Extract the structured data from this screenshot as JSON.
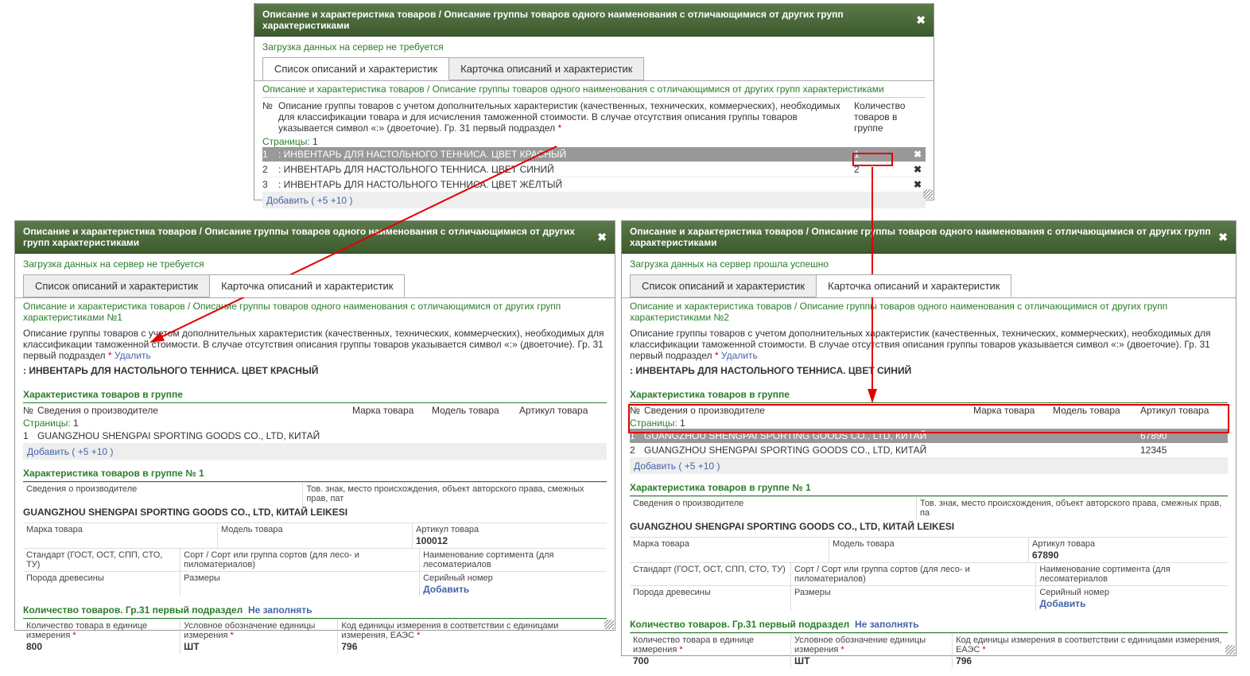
{
  "top": {
    "title": "Описание и характеристика товаров / Описание группы товаров одного наименования с отличающимися от других групп характеристиками",
    "status": "Загрузка данных на сервер не требуется",
    "tab1": "Список описаний и характеристик",
    "tab2": "Карточка описаний и характеристик",
    "breadcrumb": "Описание и характеристика товаров / Описание группы товаров одного наименования с отличающимися от других групп характеристиками",
    "colN": "№",
    "colDesc": "Описание группы товаров с учетом дополнительных характеристик (качественных, технических, коммерческих), необходимых для классификации товара и для исчисления таможенной стоимости. В случае отсутствия описания группы товаров указывается символ «:» (двоеточие). Гр. 31 первый подраздел",
    "colQty": "Количество товаров в группе",
    "pages": "Страницы:",
    "pageNum": "1",
    "rows": [
      {
        "n": "1",
        "text": ": ИНВЕНТАРЬ ДЛЯ НАСТОЛЬНОГО ТЕННИСА. ЦВЕТ КРАСНЫЙ",
        "qty": "1",
        "del": "✖"
      },
      {
        "n": "2",
        "text": ": ИНВЕНТАРЬ ДЛЯ НАСТОЛЬНОГО ТЕННИСА. ЦВЕТ СИНИЙ",
        "qty": "2",
        "del": "✖"
      },
      {
        "n": "3",
        "text": ": ИНВЕНТАРЬ ДЛЯ НАСТОЛЬНОГО ТЕННИСА. ЦВЕТ ЖЁЛТЫЙ",
        "qty": "",
        "del": "✖"
      }
    ],
    "add": "Добавить",
    "a5": "( +5",
    "a10": "+10 )"
  },
  "left": {
    "title": "Описание и характеристика товаров / Описание группы товаров одного наименования с отличающимися от других групп характеристиками",
    "status": "Загрузка данных на сервер не требуется",
    "tab1": "Список описаний и характеристик",
    "tab2": "Карточка описаний и характеристик",
    "breadcrumb": "Описание и характеристика товаров / Описание группы товаров одного наименования с отличающимися от других групп характеристиками №1",
    "descHint": "Описание группы товаров с учетом дополнительных характеристик (качественных, технических, коммерческих), необходимых для классификации таможенной стоимости. В случае отсутствия описания группы товаров указывается символ «:» (двоеточие). Гр. 31 первый подраздел",
    "delete": "Удалить",
    "descValue": ": ИНВЕНТАРЬ ДЛЯ НАСТОЛЬНОГО ТЕННИСА. ЦВЕТ КРАСНЫЙ",
    "sect1": "Характеристика товаров в группе",
    "hN": "№",
    "hMfr": "Сведения о производителе",
    "hBrand": "Марка товара",
    "hModel": "Модель товара",
    "hArt": "Артикул товара",
    "pages": "Страницы:",
    "pageNum": "1",
    "mrows": [
      {
        "n": "1",
        "mfr": "GUANGZHOU SHENGPAI SPORTING GOODS CO., LTD, КИТАЙ",
        "brand": "",
        "model": "",
        "art": ""
      }
    ],
    "add": "Добавить",
    "a5": "( +5",
    "a10": "+10 )",
    "sect2": "Характеристика товаров в группе № 1",
    "mfrLabel": "Сведения о производителе",
    "tovZnak": "Тов. знак, место происхождения, объект авторского права, смежных прав, пат",
    "mfrVal": "GUANGZHOU SHENGPAI SPORTING GOODS CO., LTD, КИТАЙ LEIKESI",
    "brandL": "Марка товара",
    "modelL": "Модель товара",
    "artL": "Артикул товара",
    "artV": "100012",
    "gostL": "Стандарт (ГОСТ, ОСТ, СПП, СТО, ТУ)",
    "sortL": "Сорт / Сорт или группа сортов (для лесо- и пиломатериалов)",
    "naimL": "Наименование сортимента (для лесоматериалов",
    "woodL": "Порода древесины",
    "sizeL": "Размеры",
    "serialL": "Серийный номер",
    "addBtn": "Добавить",
    "sect3": "Количество товаров. Гр.31 первый подраздел",
    "notFill": "Не заполнять",
    "qtyUnitL": "Количество товара в единице измерения",
    "qtyUnitV": "800",
    "condL": "Условное обозначение единицы измерения",
    "condV": "ШТ",
    "codeL": "Код единицы измерения в соответствии с единицами измерения, ЕАЭС",
    "codeV": "796"
  },
  "right": {
    "title": "Описание и характеристика товаров / Описание группы товаров одного наименования с отличающимися от других групп характеристиками",
    "status": "Загрузка данных на сервер прошла успешно",
    "tab1": "Список описаний и характеристик",
    "tab2": "Карточка описаний и характеристик",
    "breadcrumb": "Описание и характеристика товаров / Описание группы товаров одного наименования с отличающимися от других групп характеристиками №2",
    "descHint": "Описание группы товаров с учетом дополнительных характеристик (качественных, технических, коммерческих), необходимых для классификации таможенной стоимости. В случае отсутствия описания группы товаров указывается символ «:» (двоеточие). Гр. 31 первый подраздел",
    "delete": "Удалить",
    "descValue": ": ИНВЕНТАРЬ ДЛЯ НАСТОЛЬНОГО ТЕННИСА. ЦВЕТ СИНИЙ",
    "sect1": "Характеристика товаров в группе",
    "hN": "№",
    "hMfr": "Сведения о производителе",
    "hBrand": "Марка товара",
    "hModel": "Модель товара",
    "hArt": "Артикул товара",
    "pages": "Страницы:",
    "pageNum": "1",
    "mrows": [
      {
        "n": "1",
        "mfr": "GUANGZHOU SHENGPAI SPORTING GOODS CO., LTD, КИТАЙ",
        "brand": "",
        "model": "",
        "art": "67890"
      },
      {
        "n": "2",
        "mfr": "GUANGZHOU SHENGPAI SPORTING GOODS CO., LTD, КИТАЙ",
        "brand": "",
        "model": "",
        "art": "12345"
      }
    ],
    "add": "Добавить",
    "a5": "( +5",
    "a10": "+10 )",
    "sect2": "Характеристика товаров в группе № 1",
    "mfrLabel": "Сведения о производителе",
    "tovZnak": "Тов. знак, место происхождения, объект авторского права, смежных прав, па",
    "mfrVal": "GUANGZHOU SHENGPAI SPORTING GOODS CO., LTD, КИТАЙ LEIKESI",
    "brandL": "Марка товара",
    "modelL": "Модель товара",
    "artL": "Артикул товара",
    "artV": "67890",
    "gostL": "Стандарт (ГОСТ, ОСТ, СПП, СТО, ТУ)",
    "sortL": "Сорт / Сорт или группа сортов (для лесо- и пиломатериалов)",
    "naimL": "Наименование сортимента (для лесоматериалов",
    "woodL": "Порода древесины",
    "sizeL": "Размеры",
    "serialL": "Серийный номер",
    "addBtn": "Добавить",
    "sect3": "Количество товаров. Гр.31 первый подраздел",
    "notFill": "Не заполнять",
    "qtyUnitL": "Количество товара в единице измерения",
    "qtyUnitV": "700",
    "condL": "Условное обозначение единицы измерения",
    "condV": "ШТ",
    "codeL": "Код единицы измерения в соответствии с единицами измерения, ЕАЭС",
    "codeV": "796"
  },
  "star": "*"
}
